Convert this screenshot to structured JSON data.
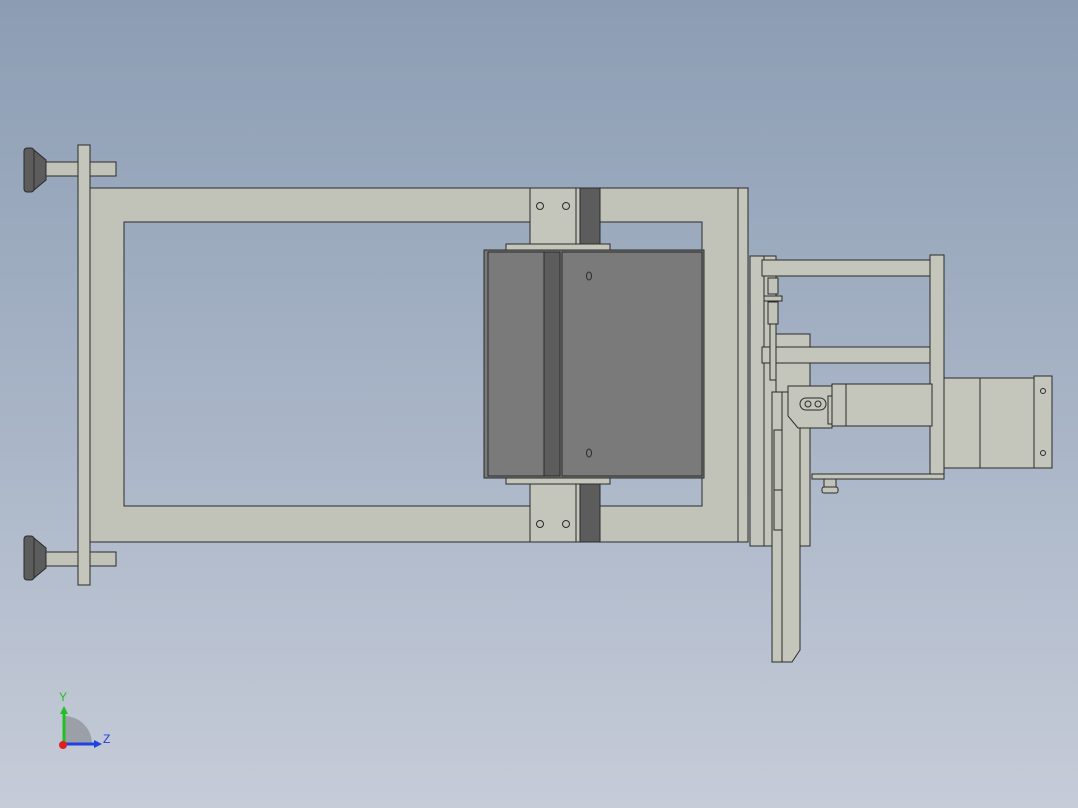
{
  "viewport": {
    "background_top": "#8c9db3",
    "background_bottom": "#c6ccd8"
  },
  "triad": {
    "y_label": "Y",
    "z_label": "Z",
    "y_color": "#20c020",
    "z_color": "#2040e0",
    "x_color": "#e02020"
  }
}
